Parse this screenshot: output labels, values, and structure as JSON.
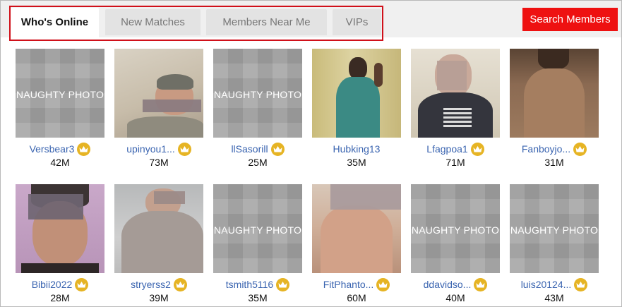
{
  "tabs": [
    "Who's Online",
    "New Matches",
    "Members Near Me",
    "VIPs"
  ],
  "search_button": "Search Members",
  "naughty_label": "NAUGHTY PHOTO",
  "colors": {
    "accent": "#ee1111",
    "link": "#3a64b0",
    "crown": "#e6b424",
    "highlight": "#d0101a"
  },
  "members": [
    {
      "name": "Versbear3",
      "age": "42M",
      "photo": "naughty"
    },
    {
      "name": "upinyou1...",
      "age": "73M",
      "photo": "photo"
    },
    {
      "name": "llSasorill",
      "age": "25M",
      "photo": "naughty"
    },
    {
      "name": "Hubking13",
      "age": "35M",
      "photo": "photo"
    },
    {
      "name": "Lfagpoa1",
      "age": "71M",
      "photo": "photo"
    },
    {
      "name": "Fanboyjo...",
      "age": "31M",
      "photo": "photo"
    },
    {
      "name": "Bibii2022",
      "age": "28M",
      "photo": "photo"
    },
    {
      "name": "stryerss2",
      "age": "39M",
      "photo": "photo"
    },
    {
      "name": "tsmith5116",
      "age": "35M",
      "photo": "naughty"
    },
    {
      "name": "FitPhanto...",
      "age": "60M",
      "photo": "photo"
    },
    {
      "name": "ddavidso...",
      "age": "40M",
      "photo": "naughty"
    },
    {
      "name": "luis20124...",
      "age": "43M",
      "photo": "naughty"
    }
  ]
}
